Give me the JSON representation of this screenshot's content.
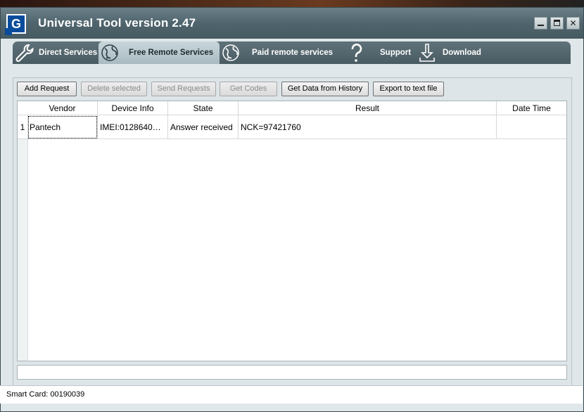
{
  "window": {
    "title": "Universal Tool version 2.47",
    "logo_letter": "G"
  },
  "nav": {
    "items": [
      {
        "label": "Direct Services",
        "icon": "wrench-icon"
      },
      {
        "label": "Free Remote Services",
        "icon": "globe-icon",
        "active": true
      },
      {
        "label": "Paid remote services",
        "icon": "globe-icon"
      },
      {
        "label": "Support",
        "icon": "question-icon"
      },
      {
        "label": "Download",
        "icon": "download-icon"
      }
    ]
  },
  "toolbar": {
    "add_request": "Add Request",
    "delete_selected": "Delete selected",
    "send_requests": "Send Requests",
    "get_codes": "Get Codes",
    "get_data_history": "Get Data  from History",
    "export_text": "Export to text file"
  },
  "table": {
    "columns": [
      "Vendor",
      "Device Info",
      "State",
      "Result",
      "Date Time"
    ],
    "rows": [
      {
        "num": "1",
        "vendor": "Pantech",
        "device_info": "IMEI:0128640…",
        "state": "Answer received",
        "result": "NCK=97421760",
        "date_time": ""
      }
    ]
  },
  "status": {
    "smart_card": "Smart Card: 00190039"
  },
  "colors": {
    "titlebar": "#4f646c",
    "navbar": "#4a5c63",
    "active_tab": "#b9c8cd",
    "logo": "#0a4c9c"
  }
}
